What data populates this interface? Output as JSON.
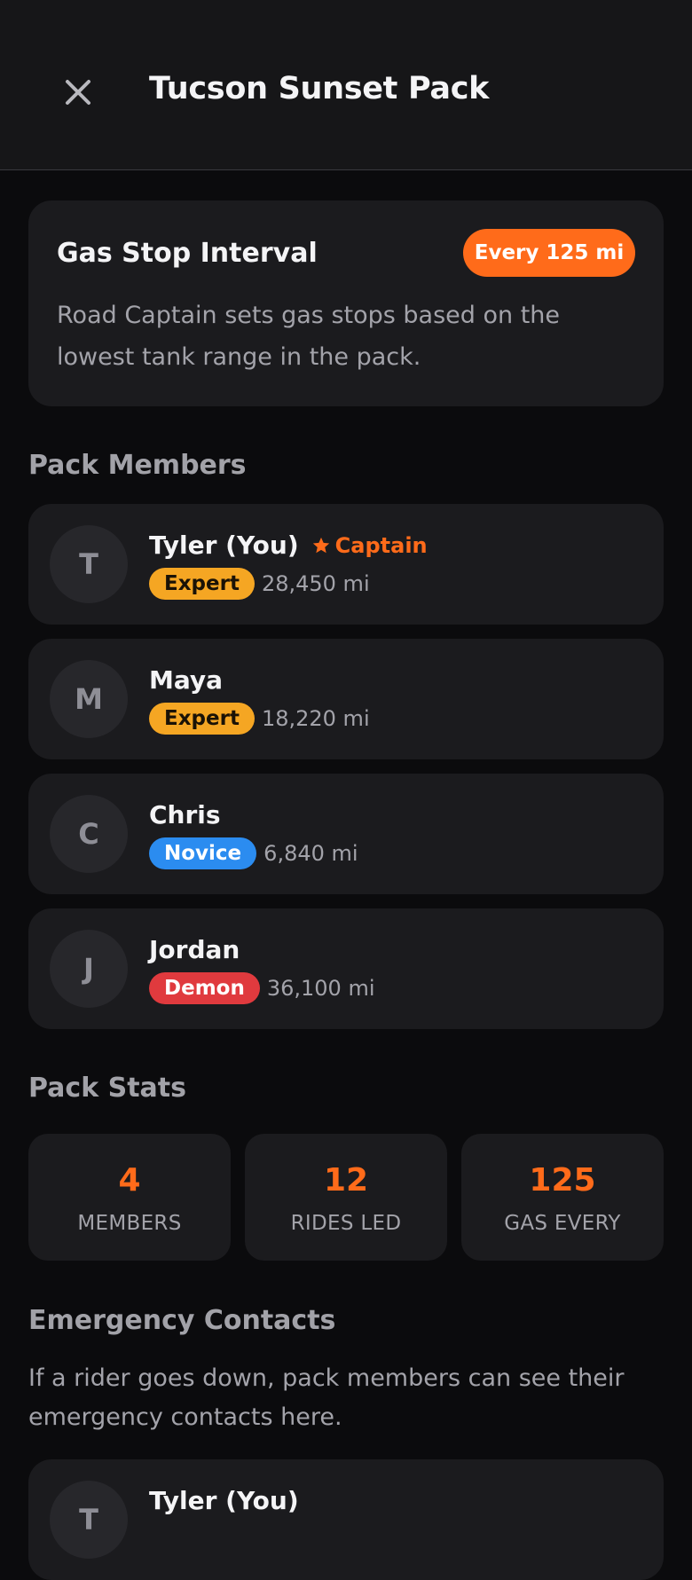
{
  "header": {
    "title": "Tucson Sunset Pack",
    "close_icon": "close-icon"
  },
  "gas_stop": {
    "title": "Gas Stop Interval",
    "pill": "Every 125 mi",
    "description": "Road Captain sets gas stops based on the lowest tank range in the pack."
  },
  "members_section": {
    "title": "Pack Members"
  },
  "members": [
    {
      "initial": "T",
      "name": "Tyler (You)",
      "role": "Captain",
      "level": "Expert",
      "miles": "28,450 mi"
    },
    {
      "initial": "M",
      "name": "Maya",
      "level": "Expert",
      "miles": "18,220 mi"
    },
    {
      "initial": "C",
      "name": "Chris",
      "level": "Novice",
      "miles": "6,840 mi"
    },
    {
      "initial": "J",
      "name": "Jordan",
      "level": "Demon",
      "miles": "36,100 mi"
    }
  ],
  "stats_section": {
    "title": "Pack Stats"
  },
  "stats": [
    {
      "value": "4",
      "label": "MEMBERS"
    },
    {
      "value": "12",
      "label": "RIDES LED"
    },
    {
      "value": "125",
      "label": "GAS EVERY"
    }
  ],
  "emergency": {
    "title": "Emergency Contacts",
    "description": "If a rider goes down, pack members can see their emergency contacts here.",
    "first_contact": {
      "initial": "T",
      "name": "Tyler (You)"
    }
  },
  "colors": {
    "accent": "#ff6b1a",
    "expert": "#f5a623",
    "novice": "#2b8cf0",
    "demon": "#e03a3e"
  }
}
